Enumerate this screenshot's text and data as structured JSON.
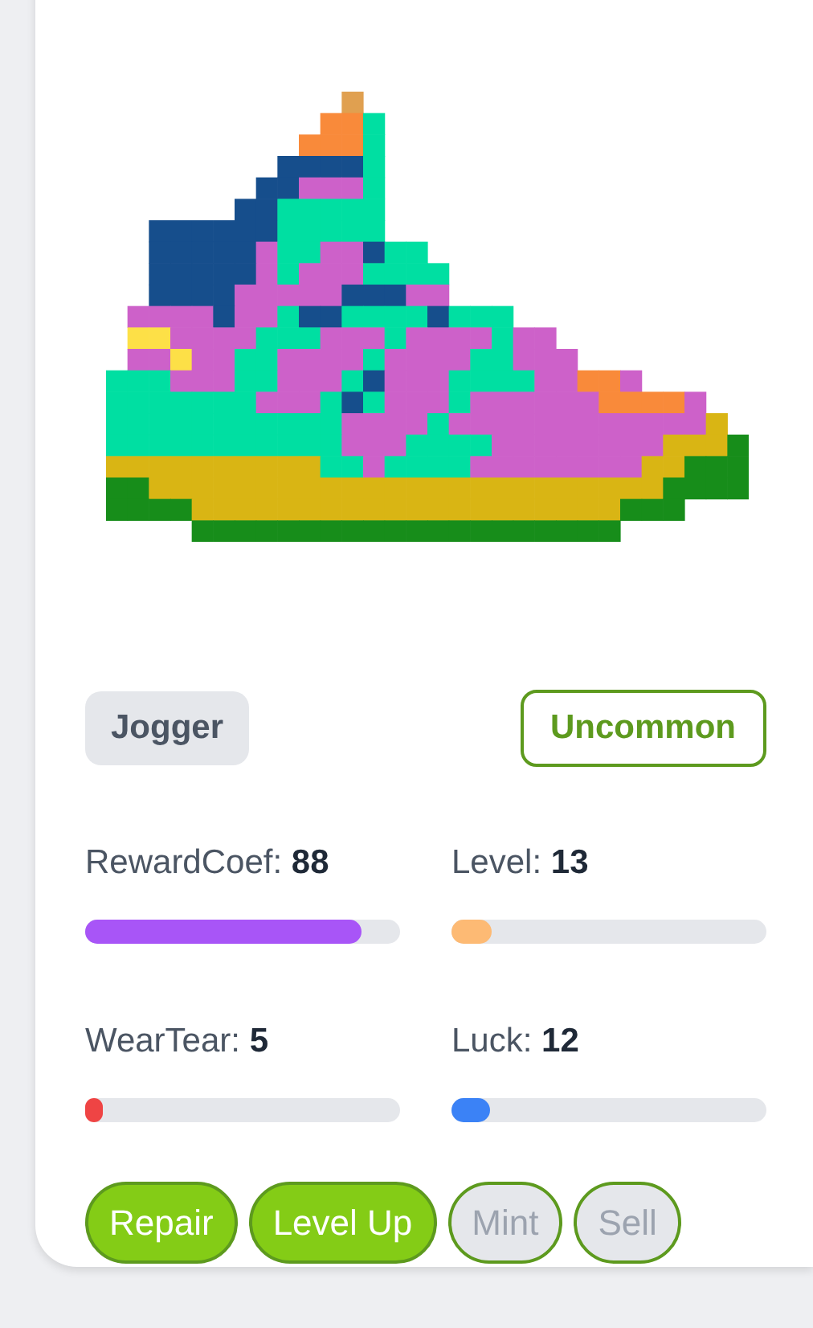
{
  "badges": [
    {
      "label": "Jogger",
      "kind": "type"
    },
    {
      "label": "Uncommon",
      "kind": "rarity"
    }
  ],
  "stats": [
    {
      "label": "RewardCoef:",
      "value": "88",
      "level": 0.88,
      "color": "#a855f7"
    },
    {
      "label": "Level:",
      "value": "13",
      "level": 0.13,
      "color": "#fdba74"
    },
    {
      "label": "WearTear:",
      "value": "5",
      "level": 0.05,
      "color": "#ef4444"
    },
    {
      "label": "Luck:",
      "value": "12",
      "level": 0.12,
      "color": "#3b82f6"
    }
  ],
  "buttons": [
    {
      "label": "Repair",
      "disabled": false
    },
    {
      "label": "Level Up",
      "disabled": false
    },
    {
      "label": "Mint",
      "disabled": true
    },
    {
      "label": "Sell",
      "disabled": true
    }
  ]
}
